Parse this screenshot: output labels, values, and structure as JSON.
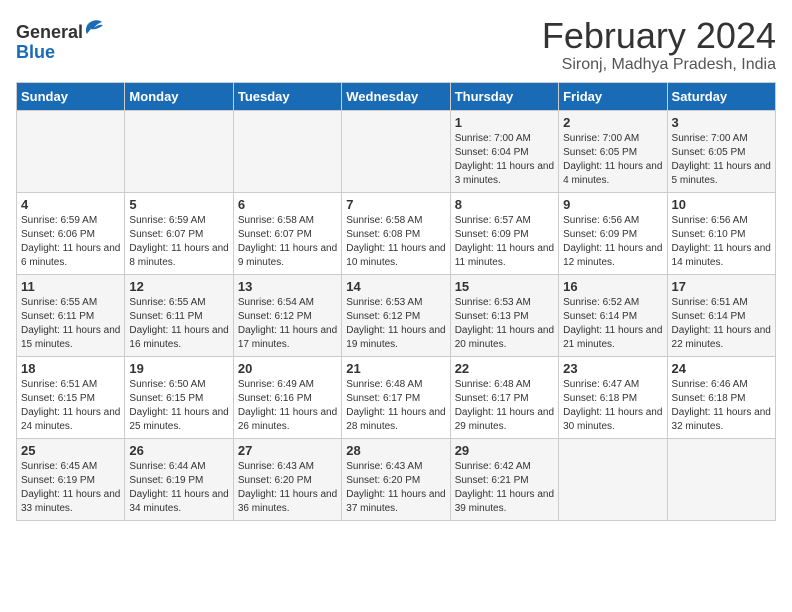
{
  "header": {
    "logo_text_general": "General",
    "logo_text_blue": "Blue",
    "title": "February 2024",
    "subtitle": "Sironj, Madhya Pradesh, India"
  },
  "days_of_week": [
    "Sunday",
    "Monday",
    "Tuesday",
    "Wednesday",
    "Thursday",
    "Friday",
    "Saturday"
  ],
  "weeks": [
    [
      {
        "day": "",
        "info": ""
      },
      {
        "day": "",
        "info": ""
      },
      {
        "day": "",
        "info": ""
      },
      {
        "day": "",
        "info": ""
      },
      {
        "day": "1",
        "info": "Sunrise: 7:00 AM\nSunset: 6:04 PM\nDaylight: 11 hours\nand 3 minutes."
      },
      {
        "day": "2",
        "info": "Sunrise: 7:00 AM\nSunset: 6:05 PM\nDaylight: 11 hours\nand 4 minutes."
      },
      {
        "day": "3",
        "info": "Sunrise: 7:00 AM\nSunset: 6:05 PM\nDaylight: 11 hours\nand 5 minutes."
      }
    ],
    [
      {
        "day": "4",
        "info": "Sunrise: 6:59 AM\nSunset: 6:06 PM\nDaylight: 11 hours\nand 6 minutes."
      },
      {
        "day": "5",
        "info": "Sunrise: 6:59 AM\nSunset: 6:07 PM\nDaylight: 11 hours\nand 8 minutes."
      },
      {
        "day": "6",
        "info": "Sunrise: 6:58 AM\nSunset: 6:07 PM\nDaylight: 11 hours\nand 9 minutes."
      },
      {
        "day": "7",
        "info": "Sunrise: 6:58 AM\nSunset: 6:08 PM\nDaylight: 11 hours\nand 10 minutes."
      },
      {
        "day": "8",
        "info": "Sunrise: 6:57 AM\nSunset: 6:09 PM\nDaylight: 11 hours\nand 11 minutes."
      },
      {
        "day": "9",
        "info": "Sunrise: 6:56 AM\nSunset: 6:09 PM\nDaylight: 11 hours\nand 12 minutes."
      },
      {
        "day": "10",
        "info": "Sunrise: 6:56 AM\nSunset: 6:10 PM\nDaylight: 11 hours\nand 14 minutes."
      }
    ],
    [
      {
        "day": "11",
        "info": "Sunrise: 6:55 AM\nSunset: 6:11 PM\nDaylight: 11 hours\nand 15 minutes."
      },
      {
        "day": "12",
        "info": "Sunrise: 6:55 AM\nSunset: 6:11 PM\nDaylight: 11 hours\nand 16 minutes."
      },
      {
        "day": "13",
        "info": "Sunrise: 6:54 AM\nSunset: 6:12 PM\nDaylight: 11 hours\nand 17 minutes."
      },
      {
        "day": "14",
        "info": "Sunrise: 6:53 AM\nSunset: 6:12 PM\nDaylight: 11 hours\nand 19 minutes."
      },
      {
        "day": "15",
        "info": "Sunrise: 6:53 AM\nSunset: 6:13 PM\nDaylight: 11 hours\nand 20 minutes."
      },
      {
        "day": "16",
        "info": "Sunrise: 6:52 AM\nSunset: 6:14 PM\nDaylight: 11 hours\nand 21 minutes."
      },
      {
        "day": "17",
        "info": "Sunrise: 6:51 AM\nSunset: 6:14 PM\nDaylight: 11 hours\nand 22 minutes."
      }
    ],
    [
      {
        "day": "18",
        "info": "Sunrise: 6:51 AM\nSunset: 6:15 PM\nDaylight: 11 hours\nand 24 minutes."
      },
      {
        "day": "19",
        "info": "Sunrise: 6:50 AM\nSunset: 6:15 PM\nDaylight: 11 hours\nand 25 minutes."
      },
      {
        "day": "20",
        "info": "Sunrise: 6:49 AM\nSunset: 6:16 PM\nDaylight: 11 hours\nand 26 minutes."
      },
      {
        "day": "21",
        "info": "Sunrise: 6:48 AM\nSunset: 6:17 PM\nDaylight: 11 hours\nand 28 minutes."
      },
      {
        "day": "22",
        "info": "Sunrise: 6:48 AM\nSunset: 6:17 PM\nDaylight: 11 hours\nand 29 minutes."
      },
      {
        "day": "23",
        "info": "Sunrise: 6:47 AM\nSunset: 6:18 PM\nDaylight: 11 hours\nand 30 minutes."
      },
      {
        "day": "24",
        "info": "Sunrise: 6:46 AM\nSunset: 6:18 PM\nDaylight: 11 hours\nand 32 minutes."
      }
    ],
    [
      {
        "day": "25",
        "info": "Sunrise: 6:45 AM\nSunset: 6:19 PM\nDaylight: 11 hours\nand 33 minutes."
      },
      {
        "day": "26",
        "info": "Sunrise: 6:44 AM\nSunset: 6:19 PM\nDaylight: 11 hours\nand 34 minutes."
      },
      {
        "day": "27",
        "info": "Sunrise: 6:43 AM\nSunset: 6:20 PM\nDaylight: 11 hours\nand 36 minutes."
      },
      {
        "day": "28",
        "info": "Sunrise: 6:43 AM\nSunset: 6:20 PM\nDaylight: 11 hours\nand 37 minutes."
      },
      {
        "day": "29",
        "info": "Sunrise: 6:42 AM\nSunset: 6:21 PM\nDaylight: 11 hours\nand 39 minutes."
      },
      {
        "day": "",
        "info": ""
      },
      {
        "day": "",
        "info": ""
      }
    ]
  ]
}
